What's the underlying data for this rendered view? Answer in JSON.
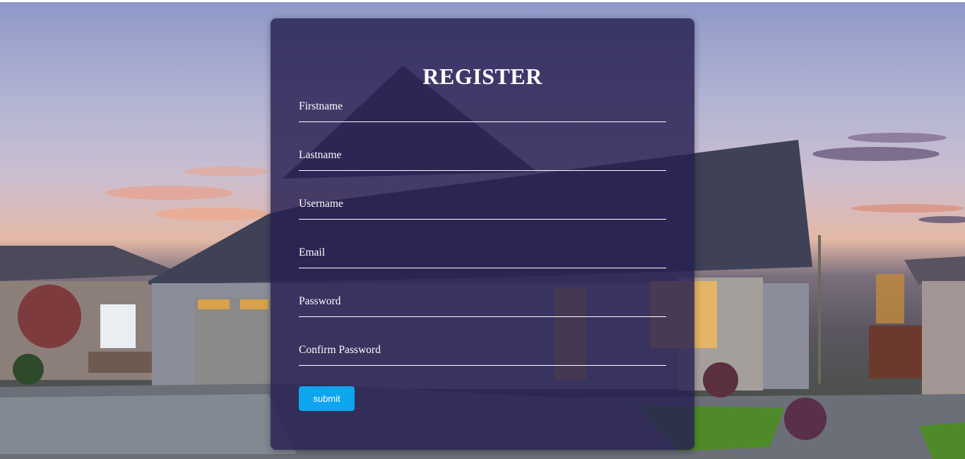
{
  "form": {
    "title": "REGISTER",
    "fields": [
      {
        "label": "Firstname",
        "value": ""
      },
      {
        "label": "Lastname",
        "value": ""
      },
      {
        "label": "Username",
        "value": ""
      },
      {
        "label": "Email",
        "value": ""
      },
      {
        "label": "Password",
        "value": ""
      },
      {
        "label": "Confirm Password",
        "value": ""
      }
    ],
    "submit_label": "submit"
  },
  "colors": {
    "panel": "#261e52",
    "button": "#0ea5ef",
    "text": "#ffffff"
  }
}
